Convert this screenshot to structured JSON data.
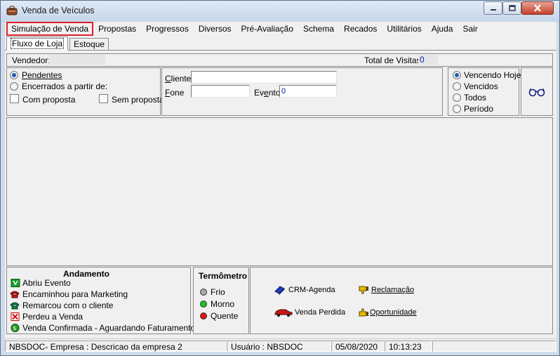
{
  "window": {
    "title": "Venda de Veículos",
    "controls": {
      "minimize_icon": "minimize-icon",
      "maximize_icon": "maximize-icon",
      "close_icon": "close-icon"
    }
  },
  "menu": [
    {
      "label": "Simulação de Venda",
      "selected": true
    },
    {
      "label": "Propostas"
    },
    {
      "label": "Progressos"
    },
    {
      "label": "Diversos"
    },
    {
      "label": "Pré-Avaliação"
    },
    {
      "label": "Schema"
    },
    {
      "label": "Recados"
    },
    {
      "label": "Utilitários"
    },
    {
      "label": "Ajuda"
    },
    {
      "label": "Sair"
    }
  ],
  "tabs": [
    {
      "label": "Fluxo de Loja",
      "active": true
    },
    {
      "label": "Estoque"
    }
  ],
  "header": {
    "vendedor_label": "Vendedor:",
    "vendedor_value": "",
    "total_visitas_label": "Total de Visitas:",
    "total_visitas_value": "0"
  },
  "filters": {
    "pendentes": "Pendentes",
    "encerrados": "Encerrados a partir de:",
    "com_proposta": "Com proposta",
    "sem_proposta": "Sem proposta",
    "selected": "pendentes"
  },
  "search": {
    "cliente_label": "Cliente",
    "cliente_value": "",
    "fone_label": "Fone",
    "fone_value": "",
    "evento_label": "Evento",
    "evento_value": "0"
  },
  "period": {
    "options": [
      "Vencendo Hoje",
      "Vencidos",
      "Todos",
      "Período"
    ],
    "selected": "Vencendo Hoje",
    "search_icon": "glasses-icon"
  },
  "andamento": {
    "title": "Andamento",
    "items": [
      {
        "label": "Abriu Evento",
        "icon": "open-event-icon"
      },
      {
        "label": "Encaminhou para Marketing",
        "icon": "phone-marketing-icon"
      },
      {
        "label": "Remarcou com o cliente",
        "icon": "phone-reschedule-icon"
      },
      {
        "label": "Perdeu a Venda",
        "icon": "lost-sale-icon"
      },
      {
        "label": "Venda Confirmada - Aguardando Faturamento",
        "icon": "confirmed-sale-icon"
      }
    ]
  },
  "termometro": {
    "title": "Termômetro",
    "items": [
      {
        "label": "Frio",
        "color": "#a9a9a9"
      },
      {
        "label": "Morno",
        "color": "#22c022"
      },
      {
        "label": "Quente",
        "color": "#e01010"
      }
    ]
  },
  "actions": {
    "crm_agenda": "CRM-Agenda",
    "reclamacao": "Reclamação",
    "venda_perdida": "Venda Perdida",
    "oportunidade": "Oportunidade"
  },
  "status": {
    "empresa": "NBSDOC- Empresa : Descricao da empresa 2",
    "usuario": "Usuário : NBSDOC",
    "data": "05/08/2020",
    "hora": "10:13:23"
  },
  "colors": {
    "selection_outline": "#e0202a",
    "value_blue": "#0018a8"
  }
}
